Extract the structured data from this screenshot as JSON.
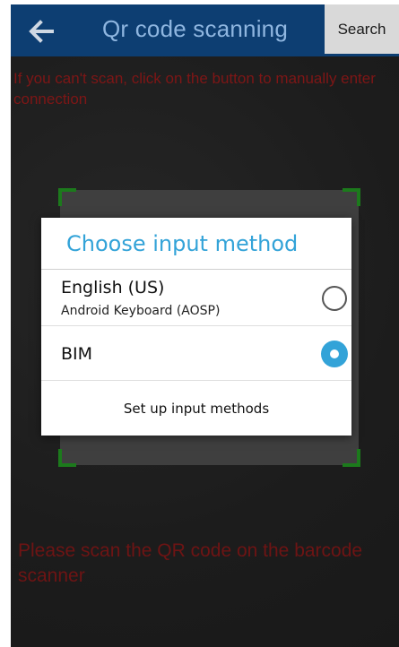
{
  "appbar": {
    "back_icon": "arrow-left-icon",
    "title": "Qr code scanning",
    "search_label": "Search"
  },
  "hints": {
    "top": "If you can't scan, click on the button to manually enter connection",
    "bottom": "Please scan the QR code on the barcode scanner"
  },
  "dialog": {
    "title": "Choose input method",
    "options": [
      {
        "label": "English (US)",
        "sublabel": "Android Keyboard (AOSP)",
        "selected": false
      },
      {
        "label": "BIM",
        "sublabel": "",
        "selected": true
      }
    ],
    "setup_label": "Set up input methods"
  },
  "colors": {
    "appbar": "#0d3e72",
    "accent": "#33a3d8",
    "hint_text": "#7e1616",
    "frame_corner": "#1c7a1c"
  }
}
